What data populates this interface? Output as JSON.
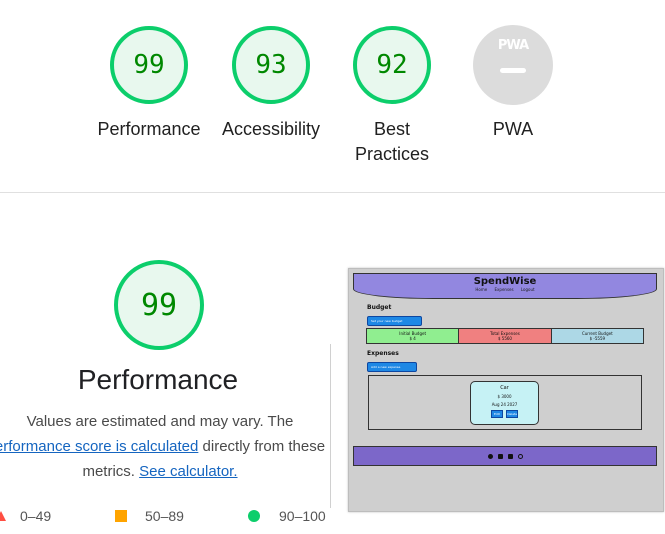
{
  "categories": [
    {
      "score": "99",
      "label": "Performance",
      "fraction": 0.99
    },
    {
      "score": "93",
      "label": "Accessibility",
      "fraction": 0.93
    },
    {
      "score": "92",
      "label_line1": "Best",
      "label_line2": "Practices",
      "fraction": 0.92
    },
    {
      "badge": "PWA",
      "label": "PWA"
    }
  ],
  "performance": {
    "score": "99",
    "fraction": 0.99,
    "title": "Performance",
    "desc_line1": "Values are estimated and may vary. The",
    "desc_link1": "erformance score is calculated",
    "desc_line2_rest": " directly from these",
    "desc_line3": "metrics. ",
    "desc_link2": "See calculator."
  },
  "legend": [
    {
      "range": "0–49"
    },
    {
      "range": "50–89"
    },
    {
      "range": "90–100"
    }
  ],
  "colors": {
    "pass": "#0cce6b",
    "pass_fill": "#e8f8ee",
    "average": "#ffa400",
    "fail": "#ff4e42",
    "pwa_grey": "#dcdcdc"
  },
  "screenshot": {
    "brand": "SpendWise",
    "nav": [
      "Home",
      "Expenses",
      "Logout"
    ],
    "budget_heading": "Budget",
    "budget_button": "Set your new budget",
    "cards": [
      {
        "title": "Initial Budget",
        "value": "$ 4",
        "color": "#90ee90"
      },
      {
        "title": "Total Expenses",
        "value": "$ 5560",
        "color": "#f08080"
      },
      {
        "title": "Current Budget",
        "value": "$ -5559",
        "color": "#add8e6"
      }
    ],
    "expenses_heading": "Expenses",
    "expenses_button": "Add a new expense",
    "expense": {
      "name": "Car",
      "amount": "$ 3000",
      "date": "Aug 24 2027",
      "edit": "Edit",
      "delete": "Delete"
    }
  }
}
